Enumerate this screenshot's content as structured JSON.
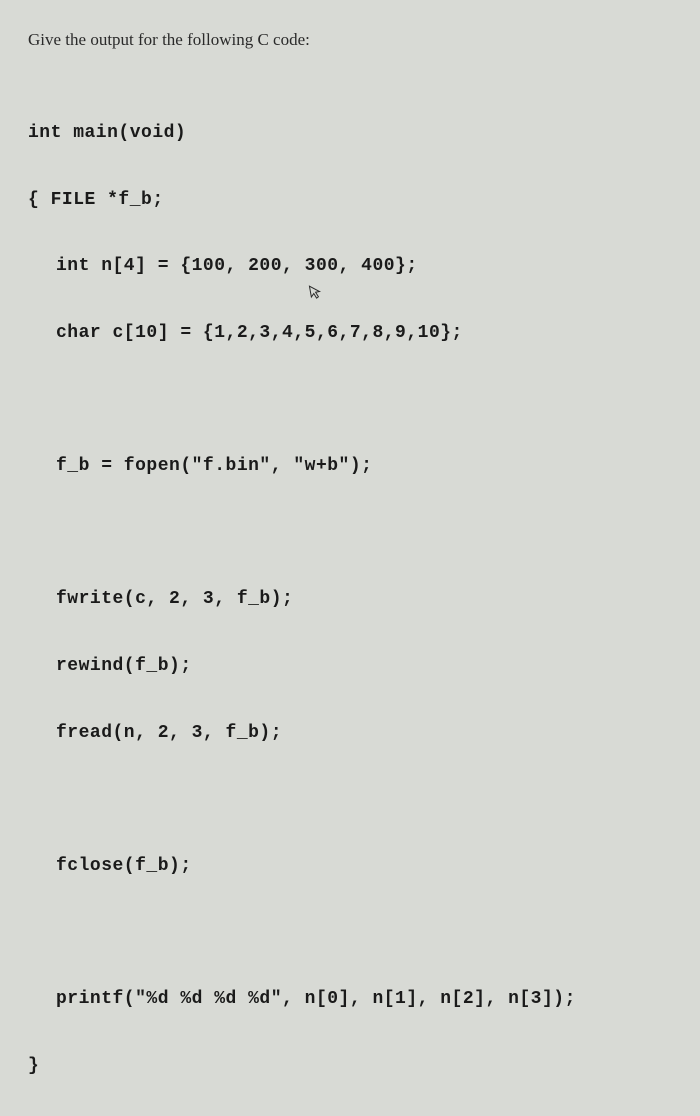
{
  "question": "Give the output for the following C code:",
  "code": {
    "line1": "int main(void)",
    "line2": "{ FILE *f_b;",
    "line3": "int n[4] = {100, 200, 300, 400};",
    "line4": "char c[10] = {1,2,3,4,5,6,7,8,9,10};",
    "line5": "",
    "line6": "f_b = fopen(\"f.bin\", \"w+b\");",
    "line7": "",
    "line8": "fwrite(c, 2, 3, f_b);",
    "line9": "rewind(f_b);",
    "line10": "fread(n, 2, 3, f_b);",
    "line11": "",
    "line12": "fclose(f_b);",
    "line13": "",
    "line14": "printf(\"%d %d %d %d\", n[0], n[1], n[2], n[3]);",
    "line15": "}"
  },
  "cursor_icon": "⇱"
}
